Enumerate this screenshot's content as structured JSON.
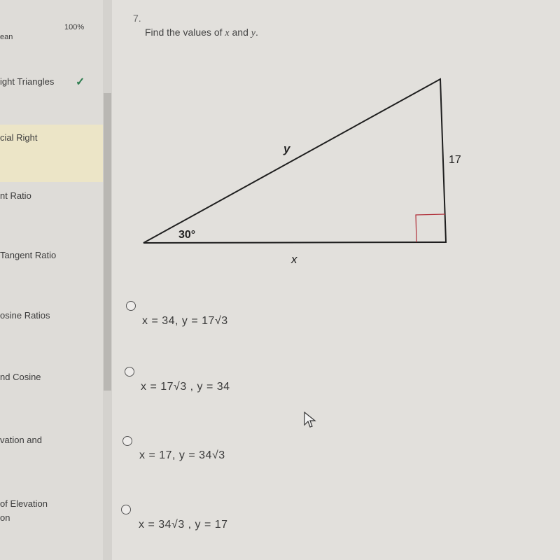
{
  "sidebar": {
    "progress_pct": "100%",
    "items": [
      {
        "label": "ean",
        "completed": false
      },
      {
        "label": "ight Triangles",
        "completed": true
      },
      {
        "label": "cial Right",
        "active": true
      },
      {
        "label": "nt Ratio"
      },
      {
        "label": "Tangent Ratio"
      },
      {
        "label": "osine Ratios"
      },
      {
        "label": "nd Cosine"
      },
      {
        "label": "vation and"
      },
      {
        "label": "of Elevation"
      },
      {
        "label": "on"
      }
    ]
  },
  "question": {
    "number": "7.",
    "prompt_prefix": "Find the values of ",
    "var_x": "x",
    "prompt_and": " and ",
    "var_y": "y",
    "prompt_suffix": ".",
    "figure": {
      "angle_label": "30°",
      "hyp_label": "y",
      "leg_label": "17",
      "base_label": "x",
      "right_angle_color": "#b0303a"
    },
    "choices": [
      {
        "text": "x = 34, y = 17√3"
      },
      {
        "text": "x = 17√3 , y = 34"
      },
      {
        "text": "x = 17, y = 34√3"
      },
      {
        "text": "x = 34√3 , y = 17"
      }
    ]
  }
}
